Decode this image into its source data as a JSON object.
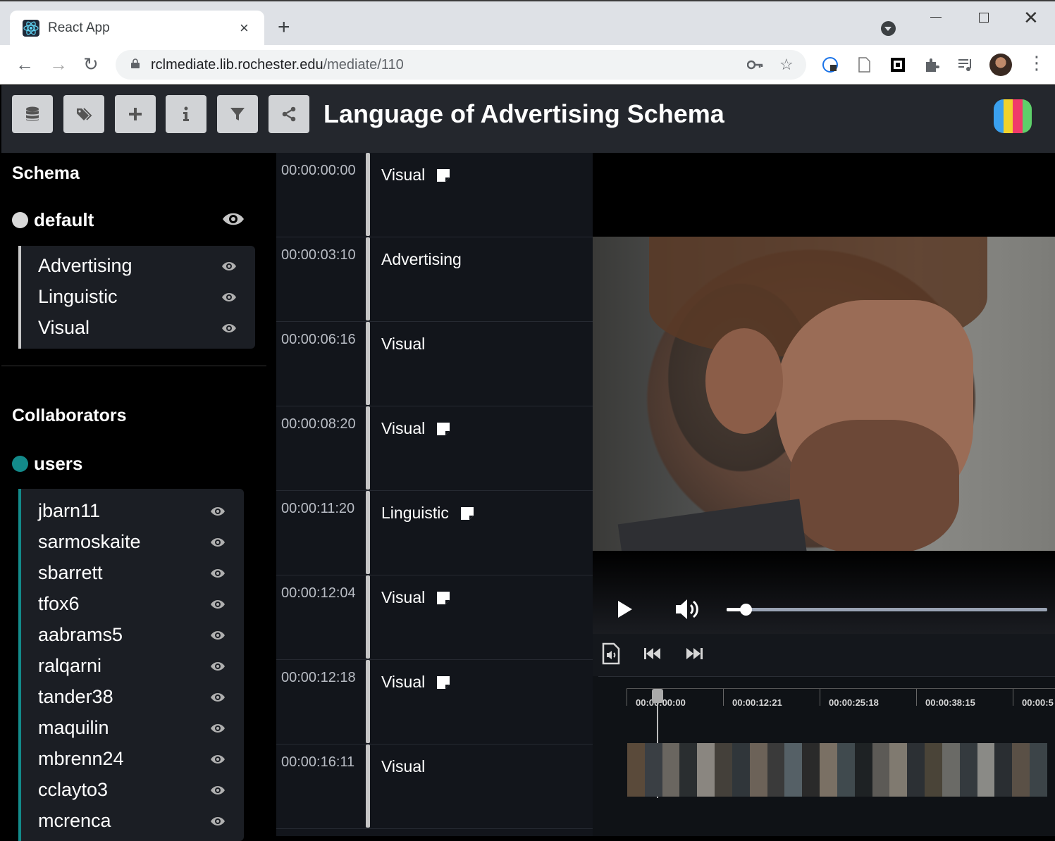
{
  "browser": {
    "tab_title": "React App",
    "tab_close": "×",
    "new_tab": "+",
    "url_host": "rclmediate.lib.rochester.edu",
    "url_path": "/mediate/110"
  },
  "header": {
    "title": "Language of Advertising Schema",
    "buttons": [
      "database-icon",
      "tags-icon",
      "plus-icon",
      "info-icon",
      "filter-icon",
      "share-icon"
    ]
  },
  "sidebar": {
    "schema_heading": "Schema",
    "schema_group": {
      "name": "default",
      "dot_color": "#d9d9d9"
    },
    "schema_items": [
      {
        "label": "Advertising"
      },
      {
        "label": "Linguistic"
      },
      {
        "label": "Visual"
      }
    ],
    "collaborators_heading": "Collaborators",
    "collab_group": {
      "name": "users",
      "dot_color": "#138a8a"
    },
    "users": [
      {
        "label": "jbarn11"
      },
      {
        "label": "sarmoskaite"
      },
      {
        "label": "sbarrett"
      },
      {
        "label": "tfox6"
      },
      {
        "label": "aabrams5"
      },
      {
        "label": "ralqarni"
      },
      {
        "label": "tander38"
      },
      {
        "label": "maquilin"
      },
      {
        "label": "mbrenn24"
      },
      {
        "label": "cclayto3"
      },
      {
        "label": "mcrenca"
      }
    ]
  },
  "annotations": [
    {
      "time": "00:00:00:00",
      "category": "Visual",
      "has_note": true
    },
    {
      "time": "00:00:03:10",
      "category": "Advertising",
      "has_note": false
    },
    {
      "time": "00:00:06:16",
      "category": "Visual",
      "has_note": false
    },
    {
      "time": "00:00:08:20",
      "category": "Visual",
      "has_note": true
    },
    {
      "time": "00:00:11:20",
      "category": "Linguistic",
      "has_note": true
    },
    {
      "time": "00:00:12:04",
      "category": "Visual",
      "has_note": true
    },
    {
      "time": "00:00:12:18",
      "category": "Visual",
      "has_note": true
    },
    {
      "time": "00:00:16:11",
      "category": "Visual",
      "has_note": false
    }
  ],
  "player": {
    "progress_fraction": 0.02,
    "timeline_ticks": [
      "00:00:00:00",
      "00:00:12:21",
      "00:00:25:18",
      "00:00:38:15",
      "00:00:5"
    ]
  },
  "colors": {
    "accent_teal": "#138a8a",
    "header_bg": "#24272d",
    "logo_stripes": [
      "#3aa0ee",
      "#f0d22c",
      "#f03a6a",
      "#5ed06a"
    ]
  }
}
